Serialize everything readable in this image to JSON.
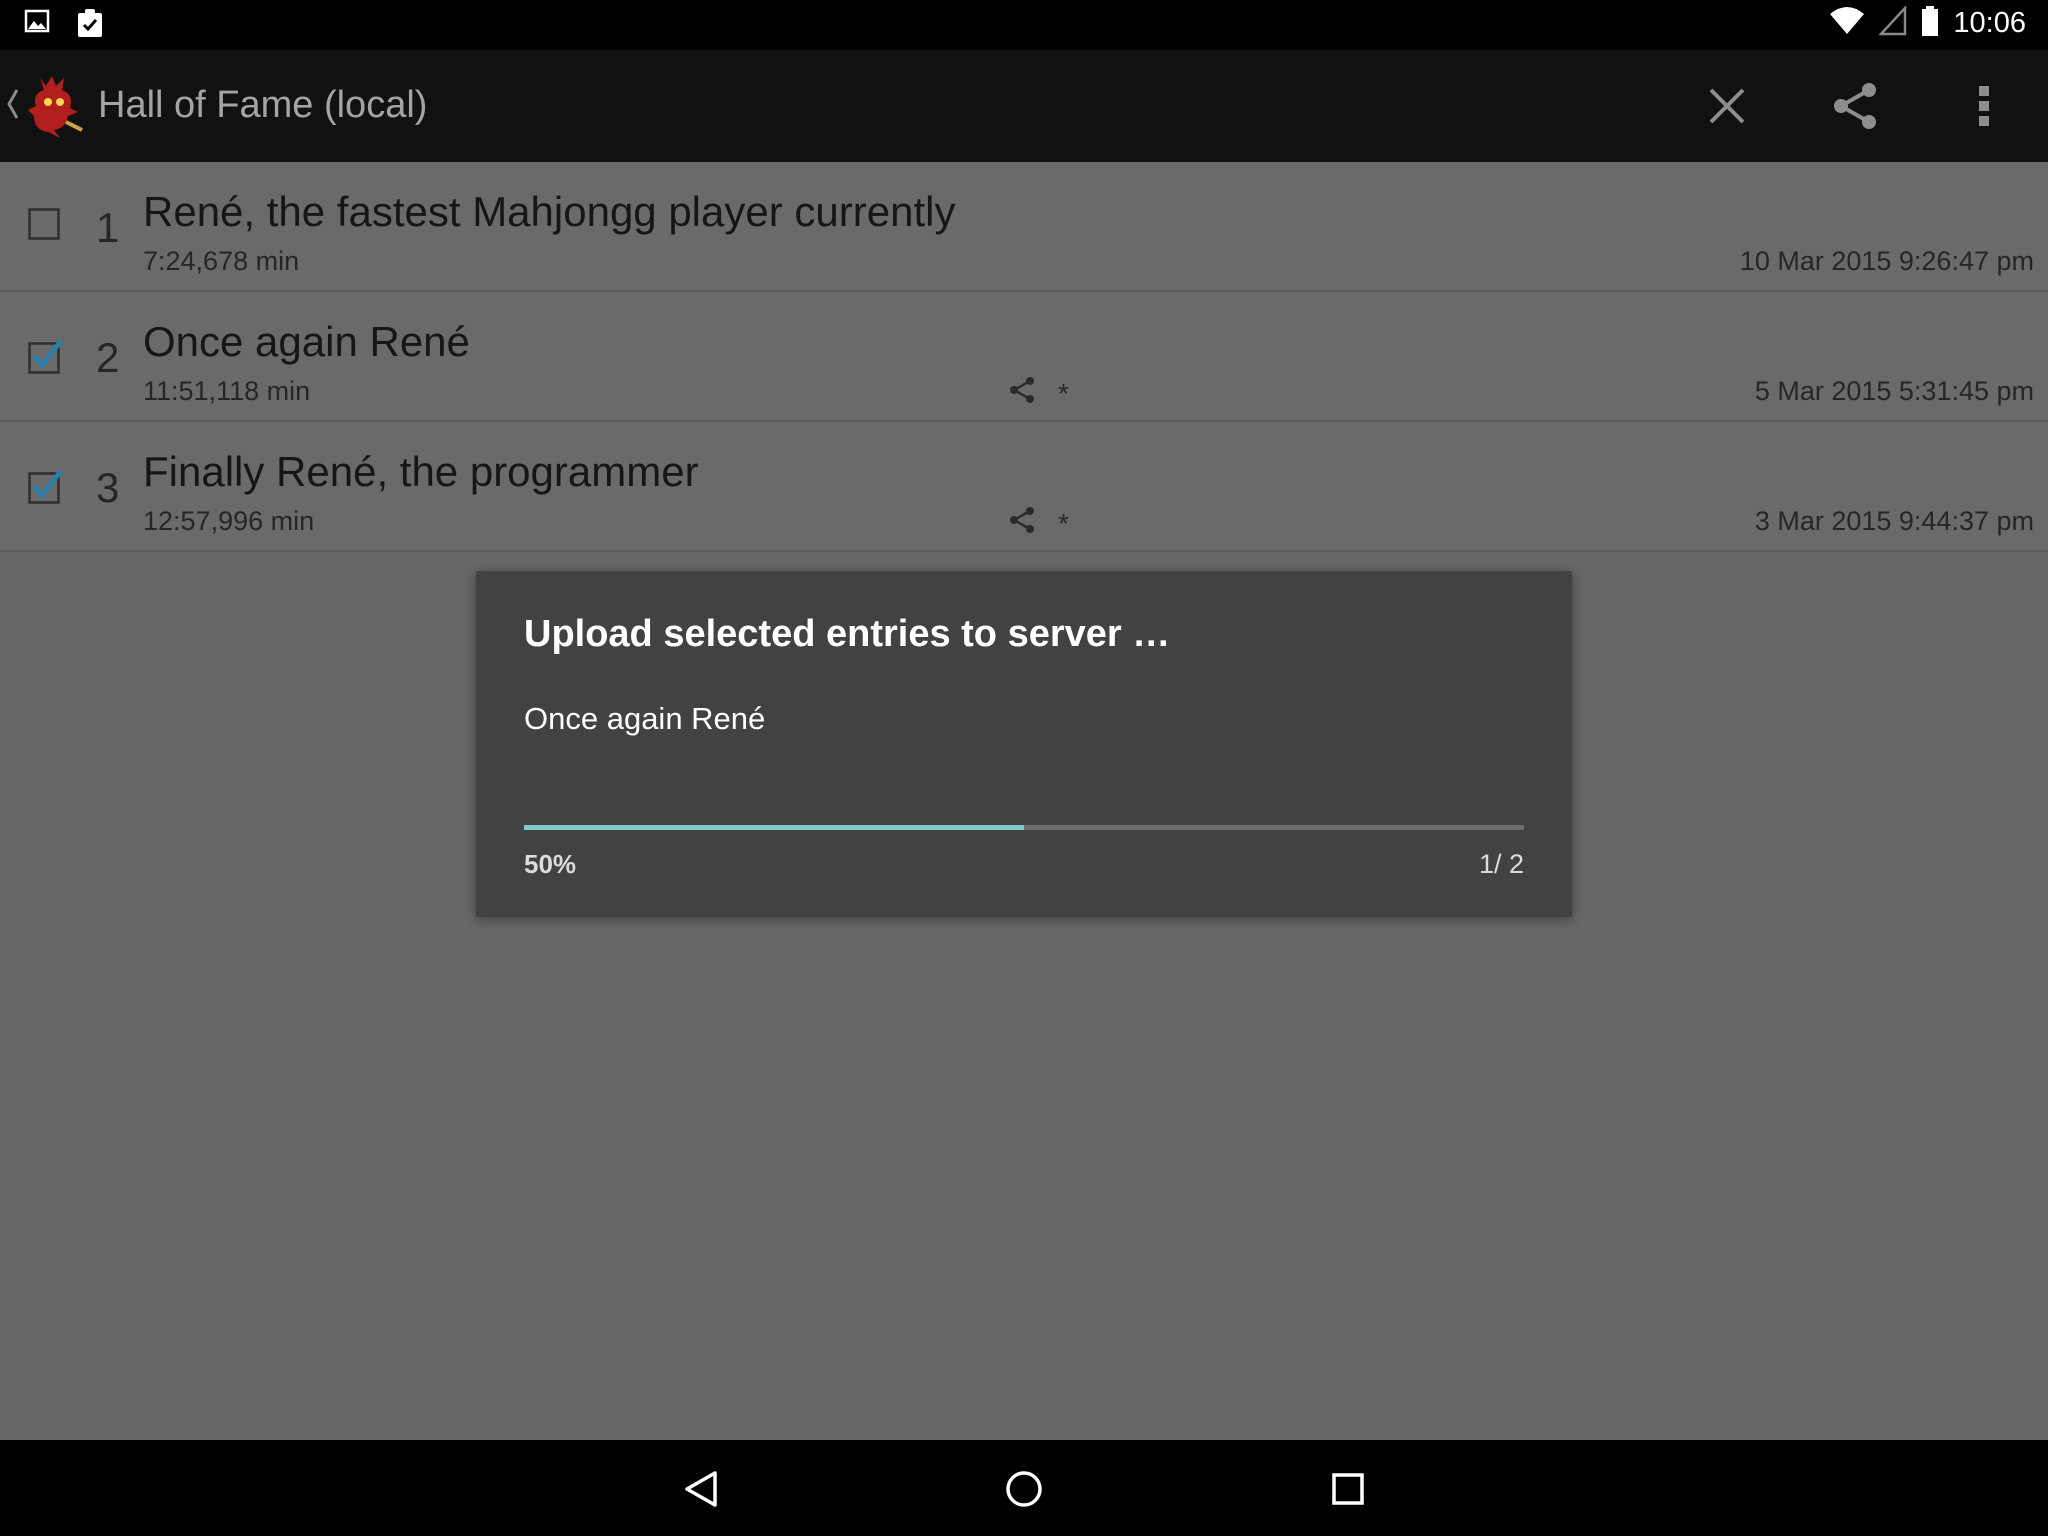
{
  "status_bar": {
    "time": "10:06",
    "left_icons": [
      "image-icon",
      "clipboard-check-icon"
    ],
    "right_icons": [
      "wifi-icon",
      "signal-icon",
      "battery-icon"
    ]
  },
  "action_bar": {
    "title": "Hall of Fame (local)",
    "actions": [
      "close-icon",
      "share-icon",
      "overflow-menu-icon"
    ]
  },
  "entries": [
    {
      "rank": "1",
      "name": "René, the fastest Mahjongg player currently",
      "time": "7:24,678 min",
      "date": "10 Mar 2015 9:26:47 pm",
      "checked": false,
      "shared": false,
      "marker": ""
    },
    {
      "rank": "2",
      "name": "Once again René",
      "time": "11:51,118 min",
      "date": "5 Mar 2015 5:31:45 pm",
      "checked": true,
      "shared": true,
      "marker": "*"
    },
    {
      "rank": "3",
      "name": "Finally René, the programmer",
      "time": "12:57,996 min",
      "date": "3 Mar 2015 9:44:37 pm",
      "checked": true,
      "shared": true,
      "marker": "*"
    }
  ],
  "dialog": {
    "title": "Upload selected entries to server …",
    "message": "Once again René",
    "progress": 0.5,
    "percent_label": "50%",
    "count_label": "1/ 2"
  },
  "colors": {
    "progress_fill": "#80cbc4",
    "checkbox_checked": "#2a7fa8"
  }
}
